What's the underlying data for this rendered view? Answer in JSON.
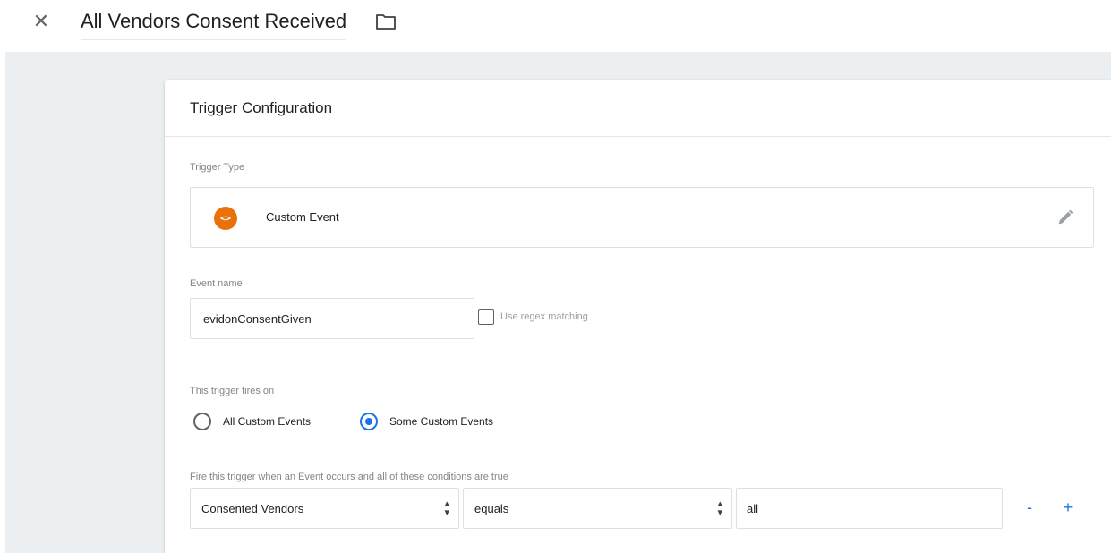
{
  "header": {
    "title": "All Vendors Consent Received",
    "close_icon": "close-icon",
    "folder_icon": "folder-icon"
  },
  "card": {
    "title": "Trigger Configuration",
    "trigger_type_label": "Trigger Type",
    "trigger_type": {
      "name": "Custom Event",
      "icon": "custom-event-icon",
      "icon_glyph": "<>",
      "icon_color": "#e8710a"
    },
    "event_name_label": "Event name",
    "event_name_value": "evidonConsentGiven",
    "regex_label": "Use regex matching",
    "regex_checked": false,
    "fires_on_label": "This trigger fires on",
    "fires_on_options": [
      {
        "label": "All Custom Events",
        "selected": false
      },
      {
        "label": "Some Custom Events",
        "selected": true
      }
    ],
    "conditions_label": "Fire this trigger when an Event occurs and all of these conditions are true",
    "condition": {
      "variable": "Consented Vendors",
      "operator": "equals",
      "value": "all",
      "remove_label": "-",
      "add_label": "+"
    }
  },
  "colors": {
    "accent": "#1a73e8",
    "canvas": "#eceff1",
    "event_icon": "#e8710a"
  }
}
